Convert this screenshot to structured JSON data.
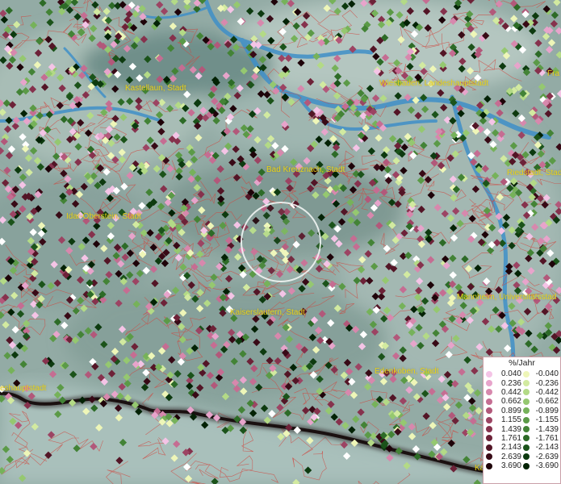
{
  "cities": [
    {
      "name": "Kastellaun, Stadt"
    },
    {
      "name": "Wiesbaden, Landeshauptstadt"
    },
    {
      "name": "Fra"
    },
    {
      "name": "Bad Kreuznach, Stadt"
    },
    {
      "name": "Riedstadt, Stad"
    },
    {
      "name": "Idar-Oberstein, Stadt"
    },
    {
      "name": "Kaiserslautern, Stadt"
    },
    {
      "name": "Mannheim, Universitätsstad"
    },
    {
      "name": "Edenkoben, Stadt"
    },
    {
      "name": "eshauptstadt"
    },
    {
      "name": "Ka"
    }
  ],
  "legend": {
    "title": "%/Jahr",
    "positive": [
      {
        "value": "0.040",
        "color": "#f4c4e6"
      },
      {
        "value": "0.236",
        "color": "#e7a4cb"
      },
      {
        "value": "0.442",
        "color": "#d788ad"
      },
      {
        "value": "0.662",
        "color": "#c56d92"
      },
      {
        "value": "0.899",
        "color": "#b2587a"
      },
      {
        "value": "1.155",
        "color": "#9c4463"
      },
      {
        "value": "1.439",
        "color": "#86324d"
      },
      {
        "value": "1.761",
        "color": "#6d2238"
      },
      {
        "value": "2.143",
        "color": "#531526"
      },
      {
        "value": "2.639",
        "color": "#380a16"
      },
      {
        "value": "3.690",
        "color": "#1e0309"
      }
    ],
    "negative": [
      {
        "value": "-0.040",
        "color": "#eef6b8"
      },
      {
        "value": "-0.236",
        "color": "#d2eaa0"
      },
      {
        "value": "-0.442",
        "color": "#b3da86"
      },
      {
        "value": "-0.662",
        "color": "#95c870"
      },
      {
        "value": "-0.899",
        "color": "#76b25a"
      },
      {
        "value": "-1.155",
        "color": "#5b9a47"
      },
      {
        "value": "-1.439",
        "color": "#438336"
      },
      {
        "value": "-1.761",
        "color": "#2d6b27"
      },
      {
        "value": "-2.143",
        "color": "#1b531a"
      },
      {
        "value": "-2.639",
        "color": "#0d3a0f"
      },
      {
        "value": "-3.690",
        "color": "#032205"
      }
    ]
  },
  "point_colors": [
    "#f4c4e6",
    "#e7a4cb",
    "#d788ad",
    "#c56d92",
    "#b2587a",
    "#9c4463",
    "#86324d",
    "#6d2238",
    "#531526",
    "#380a16",
    "#1e0309",
    "#eef6b8",
    "#d2eaa0",
    "#b3da86",
    "#95c870",
    "#76b25a",
    "#5b9a47",
    "#438336",
    "#2d6b27",
    "#1b531a",
    "#0d3a0f",
    "#032205",
    "#ffffff"
  ]
}
